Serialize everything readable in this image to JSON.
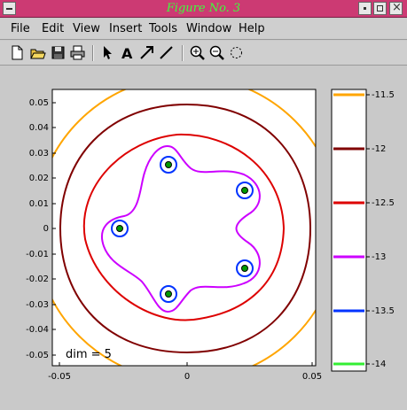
{
  "window": {
    "title": "Figure No. 3"
  },
  "menu": [
    "File",
    "Edit",
    "View",
    "Insert",
    "Tools",
    "Window",
    "Help"
  ],
  "toolbar": [
    "new-icon",
    "open-icon",
    "save-icon",
    "print-icon",
    "arrow-icon",
    "text-icon",
    "arrow-line-icon",
    "line-icon",
    "zoom-in-icon",
    "zoom-out-icon",
    "rotate-icon"
  ],
  "axes": {
    "xticks": [
      "-0.05",
      "0",
      "0.05"
    ],
    "yticks": [
      "0.05",
      "0.04",
      "0.03",
      "0.02",
      "0.01",
      "0",
      "-0.01",
      "-0.02",
      "-0.03",
      "-0.04",
      "-0.05"
    ],
    "annotation": "dim = 5"
  },
  "colorbar": {
    "labels": [
      "-11.5",
      "-12",
      "-12.5",
      "-13",
      "-13.5",
      "-14"
    ],
    "colors": [
      "#ffa500",
      "#800000",
      "#dd0000",
      "#cc00ff",
      "#0033ff",
      "#33ee33"
    ]
  },
  "chart_data": {
    "type": "contour",
    "xlim": [
      -0.055,
      0.05
    ],
    "ylim": [
      -0.055,
      0.055
    ],
    "levels": [
      -11.5,
      -12,
      -12.5,
      -13,
      -13.5,
      -14
    ],
    "level_colors": [
      "#ffa500",
      "#800000",
      "#dd0000",
      "#cc00ff",
      "#0033ff",
      "#33ee33"
    ],
    "minima": [
      [
        -0.027,
        0.0
      ],
      [
        -0.008,
        0.026
      ],
      [
        0.022,
        0.016
      ],
      [
        0.022,
        -0.016
      ],
      [
        -0.008,
        -0.026
      ]
    ],
    "annotation": "dim = 5"
  }
}
